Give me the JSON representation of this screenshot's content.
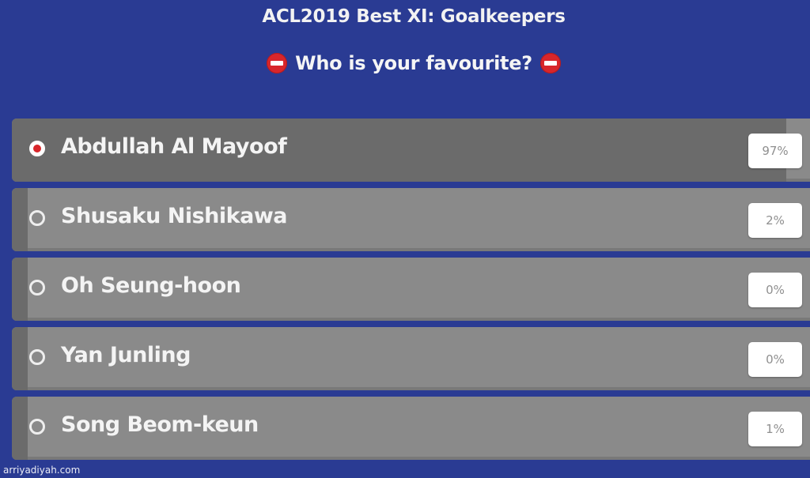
{
  "poll": {
    "title": "ACL2019 Best XI: Goalkeepers",
    "question": "Who is your favourite?",
    "question_icon": "no-entry-icon",
    "accent_color": "#d8262b",
    "background_color": "#2a3b93",
    "options": [
      {
        "name": "Abdullah Al Mayoof",
        "percent_label": "97%",
        "share": 0.97,
        "selected": true
      },
      {
        "name": "Shusaku Nishikawa",
        "percent_label": "2%",
        "share": 0.02,
        "selected": false
      },
      {
        "name": "Oh Seung-hoon",
        "percent_label": "0%",
        "share": 0.0,
        "selected": false
      },
      {
        "name": "Yan Junling",
        "percent_label": "0%",
        "share": 0.0,
        "selected": false
      },
      {
        "name": "Song Beom-keun",
        "percent_label": "1%",
        "share": 0.01,
        "selected": false
      }
    ]
  },
  "watermark": "arriyadiyah.com"
}
